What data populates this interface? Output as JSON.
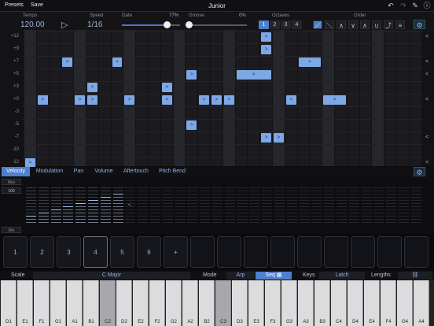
{
  "topbar": {
    "presets": "Presets",
    "save": "Save",
    "title": "Junior"
  },
  "controls": {
    "tempo_label": "Tempo",
    "tempo_value": "120.00",
    "speed_label": "Speed",
    "speed_value": "1/16",
    "gate_label": "Gate",
    "gate_value": "77%",
    "gate_level": 0.77,
    "groove_label": "Groove",
    "groove_value": "0%",
    "groove_level": 0.0,
    "octaves_label": "Octaves",
    "octaves": [
      "1",
      "2",
      "3",
      "4"
    ],
    "order_label": "Order",
    "order_icons": [
      "／",
      "＼",
      "∧",
      "∨",
      "∧",
      "∪",
      "⤴",
      "≡"
    ]
  },
  "grid": {
    "rows": [
      "+12",
      "+9",
      "+7",
      "+5",
      "+3",
      "+0",
      "-3",
      "-5",
      "-7",
      "-10",
      "-12"
    ],
    "note_label": ">",
    "notes": [
      {
        "step": 0,
        "row": 10,
        "len": 1
      },
      {
        "step": 1,
        "row": 5,
        "len": 1
      },
      {
        "step": 3,
        "row": 2,
        "len": 1
      },
      {
        "step": 4,
        "row": 5,
        "len": 1
      },
      {
        "step": 5,
        "row": 4,
        "len": 1
      },
      {
        "step": 5,
        "row": 5,
        "len": 1
      },
      {
        "step": 7,
        "row": 2,
        "len": 1
      },
      {
        "step": 8,
        "row": 5,
        "len": 1
      },
      {
        "step": 11,
        "row": 4,
        "len": 1
      },
      {
        "step": 11,
        "row": 5,
        "len": 1
      },
      {
        "step": 13,
        "row": 3,
        "len": 1
      },
      {
        "step": 13,
        "row": 7,
        "len": 1
      },
      {
        "step": 14,
        "row": 5,
        "len": 1
      },
      {
        "step": 15,
        "row": 5,
        "len": 1
      },
      {
        "step": 16,
        "row": 5,
        "len": 1
      },
      {
        "step": 17,
        "row": 3,
        "len": 3
      },
      {
        "step": 19,
        "row": 0,
        "len": 1
      },
      {
        "step": 19,
        "row": 1,
        "len": 1
      },
      {
        "step": 19,
        "row": 8,
        "len": 1
      },
      {
        "step": 20,
        "row": 8,
        "len": 1
      },
      {
        "step": 21,
        "row": 5,
        "len": 1
      },
      {
        "step": 22,
        "row": 2,
        "len": 2
      },
      {
        "step": 24,
        "row": 5,
        "len": 2
      }
    ]
  },
  "tabs": [
    "Velocity",
    "Modulation",
    "Pan",
    "Volume",
    "Aftertouch",
    "Pitch Bend"
  ],
  "velocity": {
    "max": "Max",
    "value": "100",
    "min": "Min",
    "arrow": "<"
  },
  "pads": [
    "1",
    "2",
    "3",
    "4",
    "5",
    "6",
    "+"
  ],
  "bottom": {
    "scale_label": "Scale",
    "scale_value": "C Major",
    "mode_label": "Mode",
    "arp": "Arp",
    "seq": "Seq",
    "keys_label": "Keys",
    "latch": "Latch",
    "lengths_label": "Lengths"
  },
  "keyboard": [
    "D1",
    "E1",
    "F1",
    "G1",
    "A1",
    "B1",
    "C2",
    "D2",
    "E2",
    "F2",
    "G2",
    "A2",
    "B2",
    "C3",
    "D3",
    "E3",
    "F3",
    "G3",
    "A3",
    "B3",
    "C4",
    "D4",
    "E4",
    "F4",
    "G4",
    "A4"
  ]
}
